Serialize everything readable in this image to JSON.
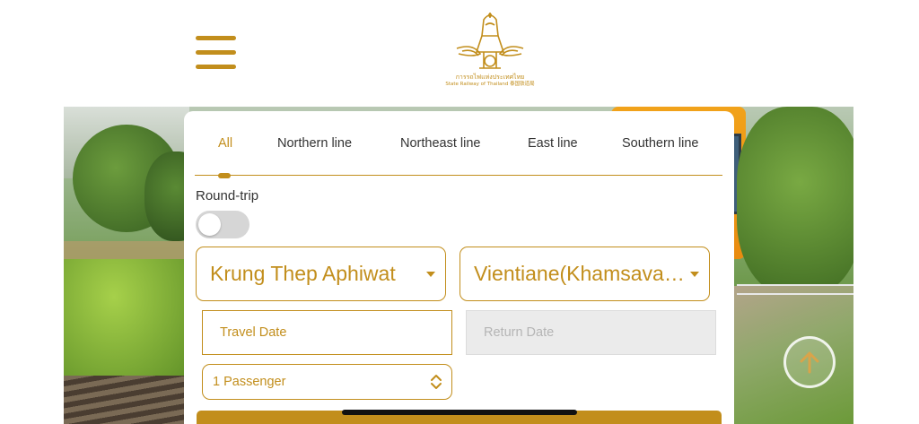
{
  "header": {
    "menu_icon": "hamburger-menu-icon",
    "logo": {
      "thai_text": "การรถไฟแห่งประเทศไทย",
      "english_text": "State Railway of Thailand 泰国铁道局"
    }
  },
  "tabs": [
    {
      "label": "All",
      "active": true
    },
    {
      "label": "Northern line",
      "active": false
    },
    {
      "label": "Northeast line",
      "active": false
    },
    {
      "label": "East line",
      "active": false
    },
    {
      "label": "Southern line",
      "active": false
    }
  ],
  "round_trip": {
    "label": "Round-trip",
    "enabled": false
  },
  "origin": {
    "value": "Krung Thep Aphiwat"
  },
  "destination": {
    "value": "Vientiane(Khamsavath)"
  },
  "travel_date": {
    "placeholder": "Travel Date"
  },
  "return_date": {
    "placeholder": "Return Date",
    "disabled": true
  },
  "passengers": {
    "value": "1 Passenger"
  },
  "colors": {
    "accent": "#c28e1c",
    "disabled_bg": "#ebebeb",
    "toggle_off": "#d6d6d6"
  },
  "icons": {
    "scroll_top": "arrow-up-icon",
    "passenger_stepper": "chevron-up-down-icon",
    "dropdown": "caret-down-icon"
  }
}
